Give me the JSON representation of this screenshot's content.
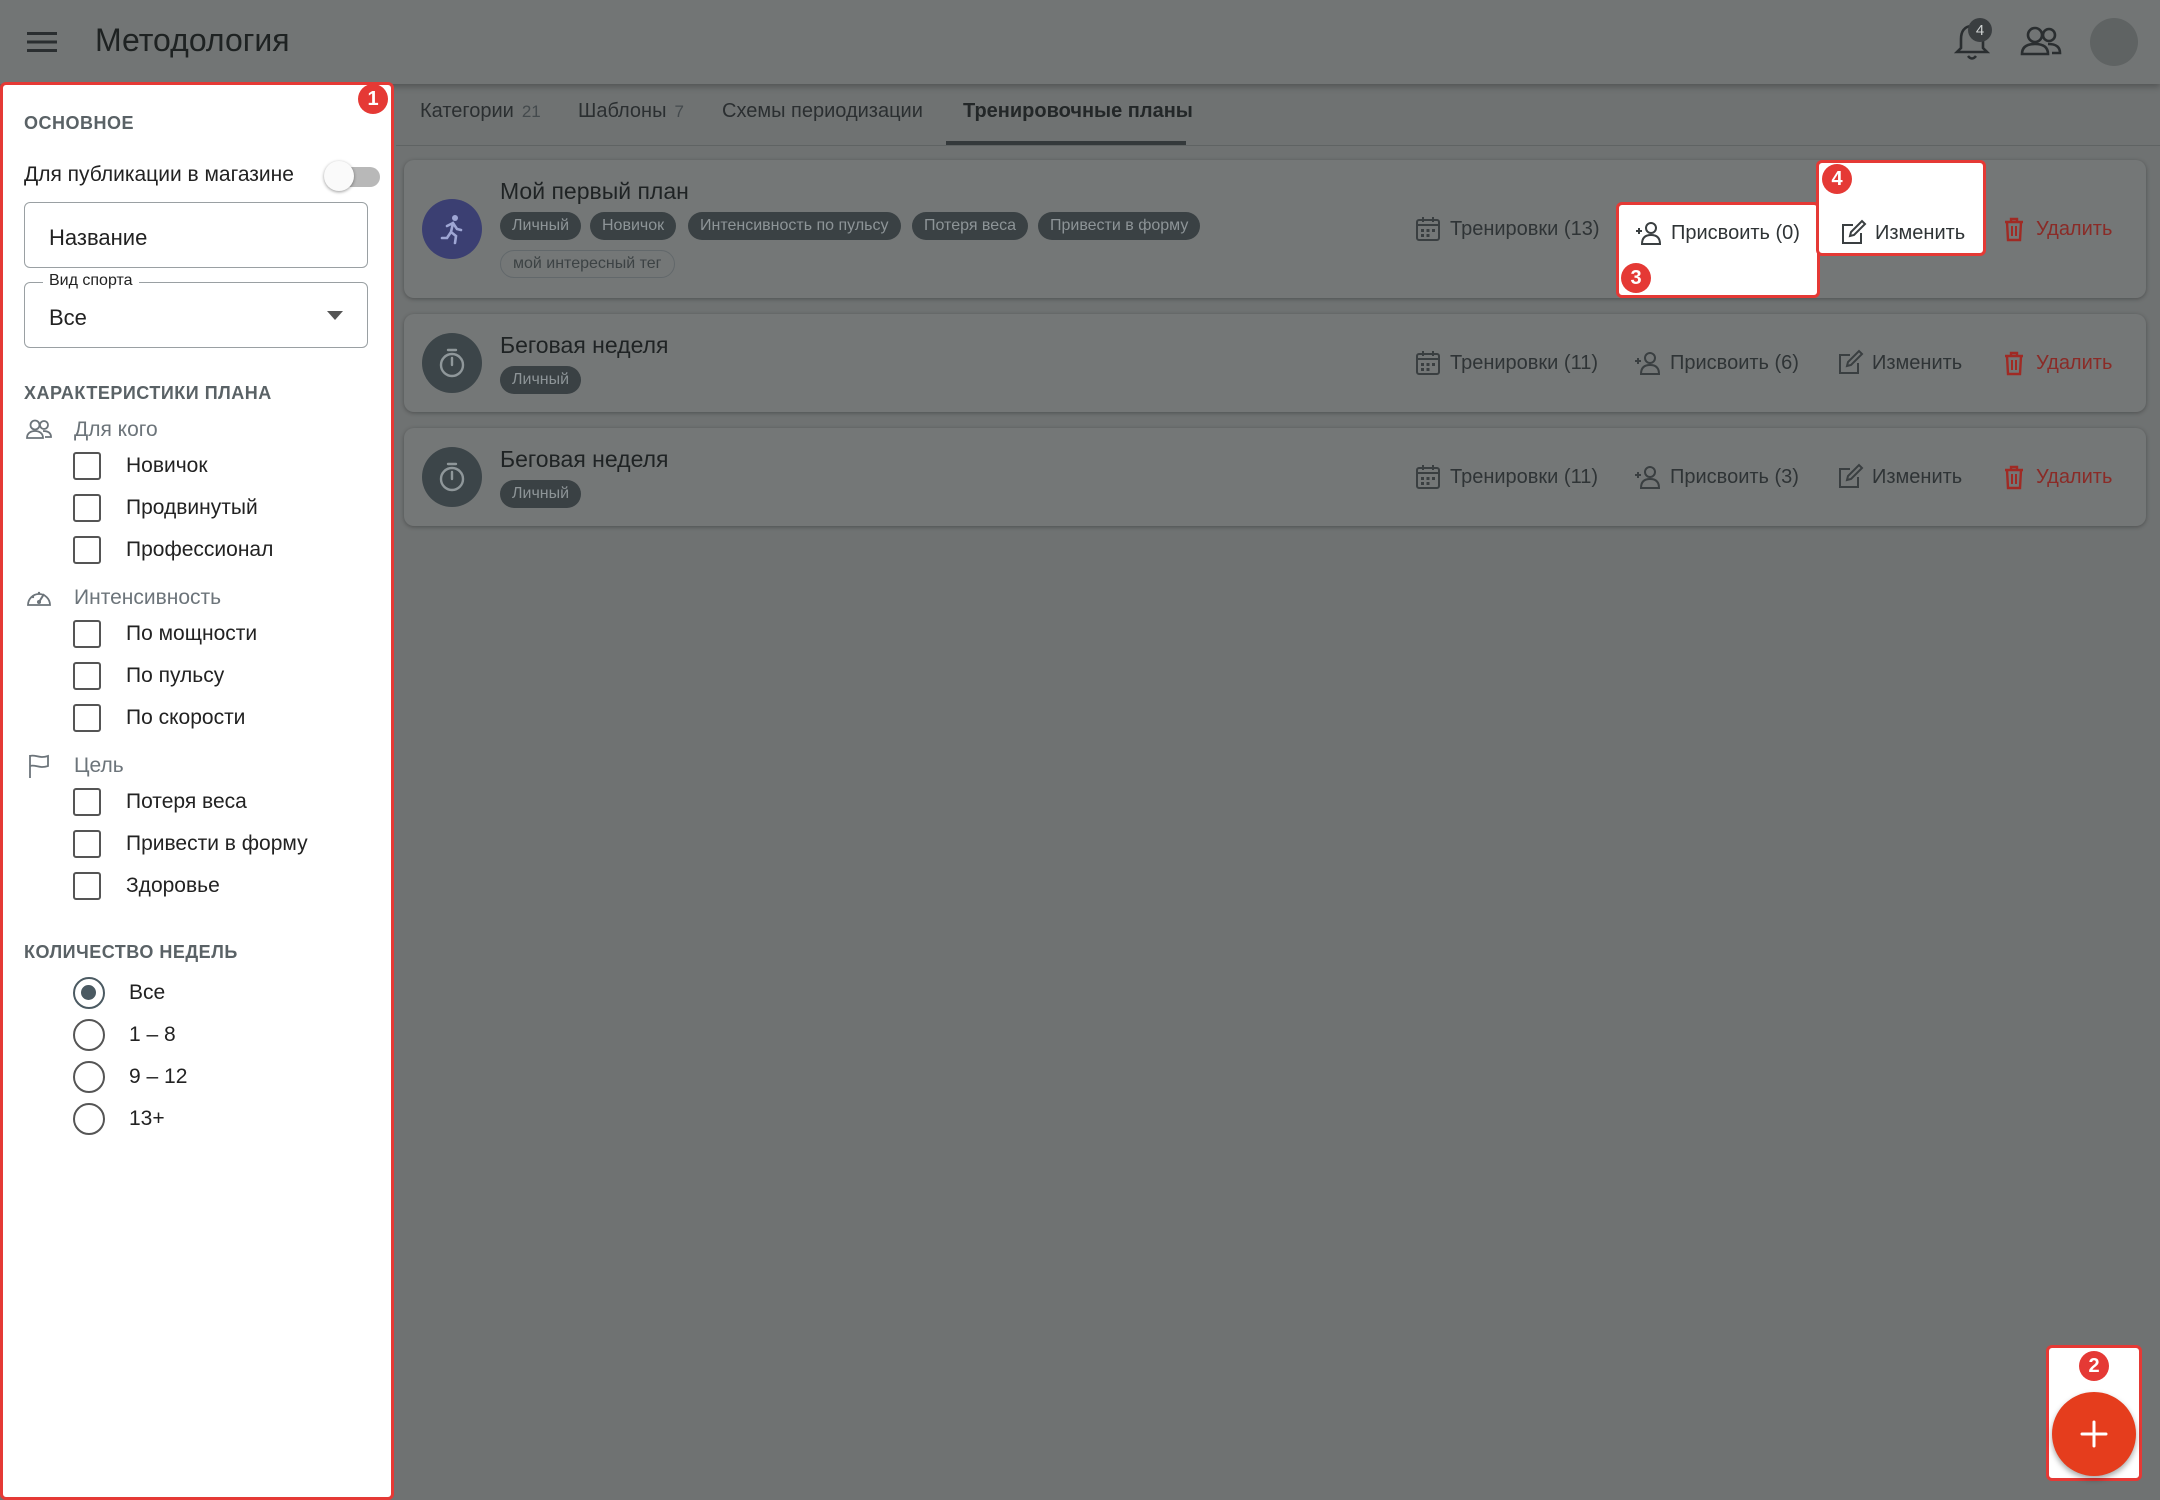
{
  "header": {
    "title": "Методология",
    "notification_count": "4"
  },
  "sidebar": {
    "section_main": "ОСНОВНОЕ",
    "publish_toggle_label": "Для публикации в магазине",
    "publish_toggle_on": false,
    "name_field_value": "Название",
    "sport_field_label": "Вид спорта",
    "sport_field_value": "Все",
    "section_characteristics": "ХАРАКТЕРИСТИКИ ПЛАНА",
    "groups": [
      {
        "title": "Для кого",
        "icon": "people-icon",
        "options": [
          "Новичок",
          "Продвинутый",
          "Профессионал"
        ]
      },
      {
        "title": "Интенсивность",
        "icon": "gauge-icon",
        "options": [
          "По мощности",
          "По пульсу",
          "По скорости"
        ]
      },
      {
        "title": "Цель",
        "icon": "flag-icon",
        "options": [
          "Потеря веса",
          "Привести в форму",
          "Здоровье"
        ]
      }
    ],
    "section_weeks": "КОЛИЧЕСТВО НЕДЕЛЬ",
    "weeks_options": [
      "Все",
      "1 – 8",
      "9 – 12",
      "13+"
    ],
    "weeks_selected": "Все"
  },
  "tabs": [
    {
      "label": "Категории",
      "count": "21"
    },
    {
      "label": "Шаблоны",
      "count": "7"
    },
    {
      "label": "Схемы периодизации",
      "count": ""
    },
    {
      "label": "Тренировочные планы",
      "count": "",
      "active": true
    }
  ],
  "plans": [
    {
      "title": "Мой первый план",
      "icon": "running-person-icon",
      "icon_bg": "#3b3f72",
      "tags": [
        "Личный",
        "Новичок",
        "Интенсивность по пульсу",
        "Потеря веса",
        "Привести в форму"
      ],
      "outline_tags": [
        "мой интересный тег"
      ],
      "workouts": "Тренировки (13)",
      "assign": "Присвоить (0)",
      "edit": "Изменить",
      "delete": "Удалить"
    },
    {
      "title": "Беговая неделя",
      "icon": "stopwatch-icon",
      "icon_bg": "#3c4549",
      "tags": [
        "Личный"
      ],
      "outline_tags": [],
      "workouts": "Тренировки (11)",
      "assign": "Присвоить (6)",
      "edit": "Изменить",
      "delete": "Удалить"
    },
    {
      "title": "Беговая неделя",
      "icon": "stopwatch-icon",
      "icon_bg": "#3c4549",
      "tags": [
        "Личный"
      ],
      "outline_tags": [],
      "workouts": "Тренировки (11)",
      "assign": "Присвоить (3)",
      "edit": "Изменить",
      "delete": "Удалить"
    }
  ],
  "markers": [
    "1",
    "2",
    "3",
    "4"
  ],
  "colors": {
    "accent_red": "#e53935",
    "fab": "#e53d1d",
    "delete": "#8a2b27"
  }
}
